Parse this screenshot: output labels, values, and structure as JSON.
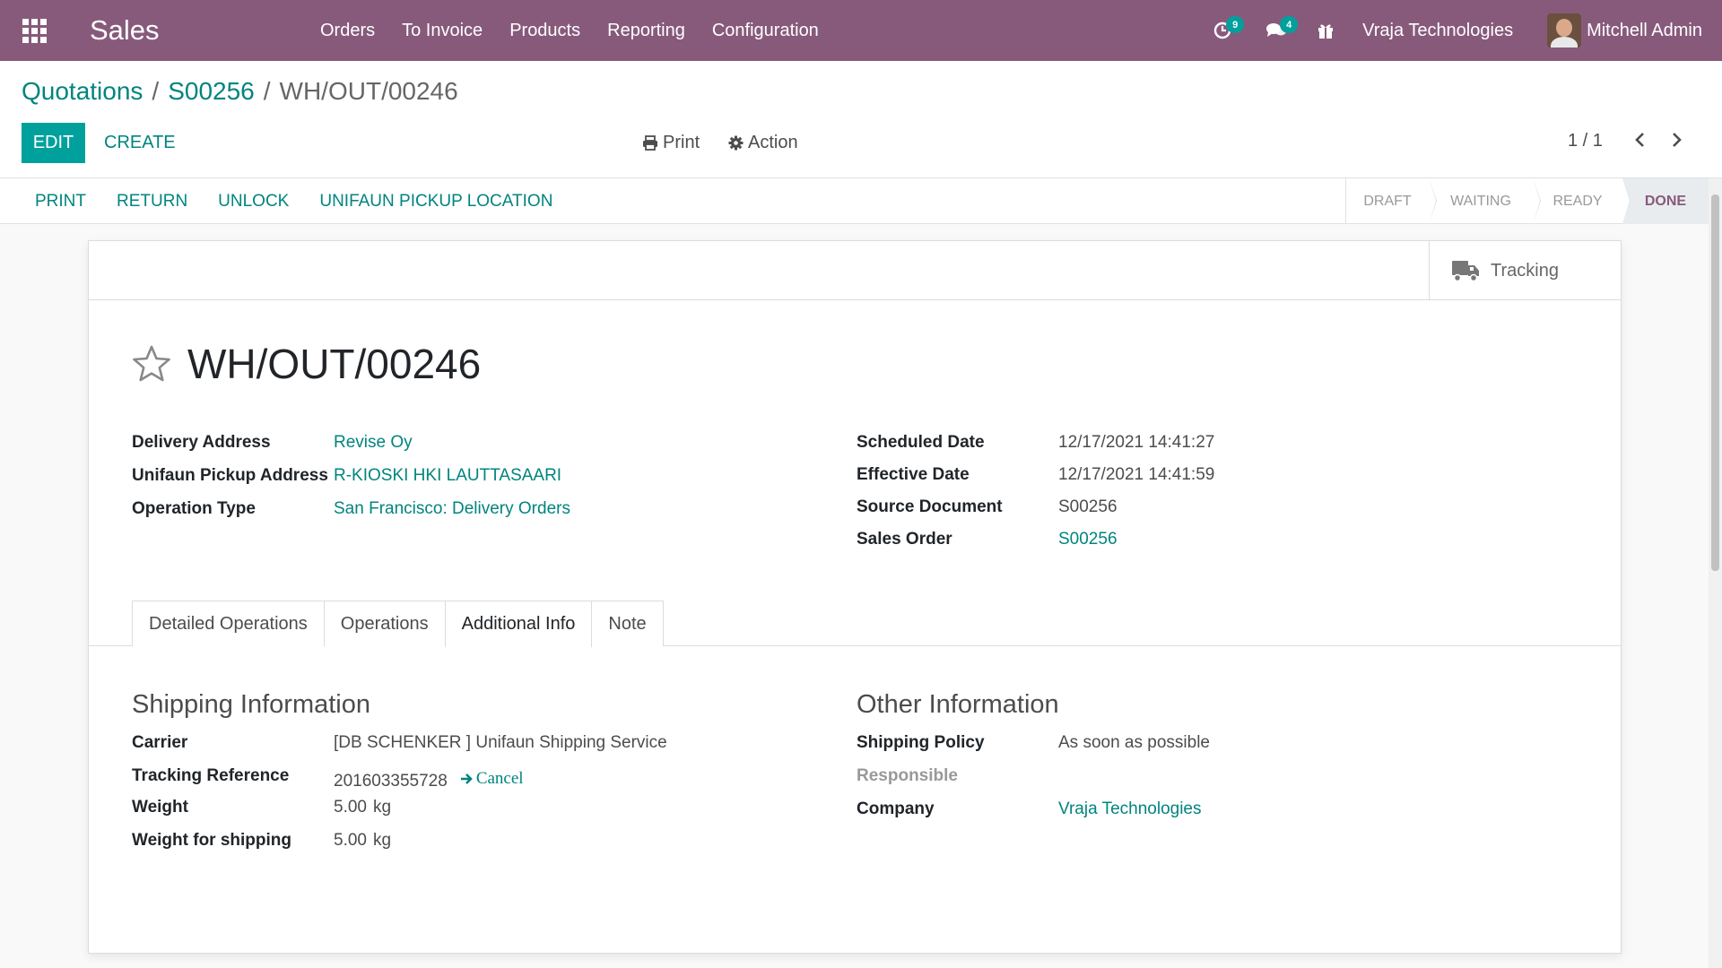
{
  "navbar": {
    "app_name": "Sales",
    "menu": [
      "Orders",
      "To Invoice",
      "Products",
      "Reporting",
      "Configuration"
    ],
    "activity_count": "9",
    "message_count": "4",
    "company": "Vraja Technologies",
    "user": "Mitchell Admin"
  },
  "breadcrumb": {
    "items": [
      "Quotations",
      "S00256"
    ],
    "separator": "/",
    "current": "WH/OUT/00246"
  },
  "control": {
    "edit_label": "EDIT",
    "create_label": "CREATE",
    "print_label": "Print",
    "action_label": "Action",
    "pager": "1 / 1"
  },
  "statusbar": {
    "buttons": [
      "PRINT",
      "RETURN",
      "UNLOCK",
      "UNIFAUN PICKUP LOCATION"
    ],
    "stages": [
      "DRAFT",
      "WAITING",
      "READY",
      "DONE"
    ],
    "current_stage": "DONE"
  },
  "smart_buttons": {
    "tracking_label": "Tracking"
  },
  "record": {
    "name": "WH/OUT/00246",
    "left_fields": [
      {
        "label": "Delivery Address",
        "value": "Revise Oy"
      },
      {
        "label": "Unifaun Pickup Address",
        "value": "R-KIOSKI HKI LAUTTASAARI"
      },
      {
        "label": "Operation Type",
        "value": "San Francisco: Delivery Orders"
      }
    ],
    "right_fields": [
      {
        "label": "Scheduled Date",
        "value": "12/17/2021 14:41:27"
      },
      {
        "label": "Effective Date",
        "value": "12/17/2021 14:41:59"
      },
      {
        "label": "Source Document",
        "value": "S00256"
      },
      {
        "label": "Sales Order",
        "value": "S00256"
      }
    ]
  },
  "tabs": [
    "Detailed Operations",
    "Operations",
    "Additional Info",
    "Note"
  ],
  "active_tab": "Additional Info",
  "shipping": {
    "title": "Shipping Information",
    "carrier_label": "Carrier",
    "carrier": "[DB SCHENKER ] Unifaun Shipping Service",
    "tracking_label": "Tracking Reference",
    "tracking_ref": "201603355728",
    "cancel_label": "Cancel",
    "weight_label": "Weight",
    "weight": "5.00",
    "weight_unit": "kg",
    "shipping_weight_label": "Weight for shipping",
    "shipping_weight": "5.00",
    "shipping_weight_unit": "kg"
  },
  "other": {
    "title": "Other Information",
    "policy_label": "Shipping Policy",
    "policy": "As soon as possible",
    "responsible_label": "Responsible",
    "responsible": "",
    "company_label": "Company",
    "company": "Vraja Technologies"
  },
  "colors": {
    "navbar": "#875a7b",
    "primary": "#00a09d",
    "link": "#00847f"
  }
}
